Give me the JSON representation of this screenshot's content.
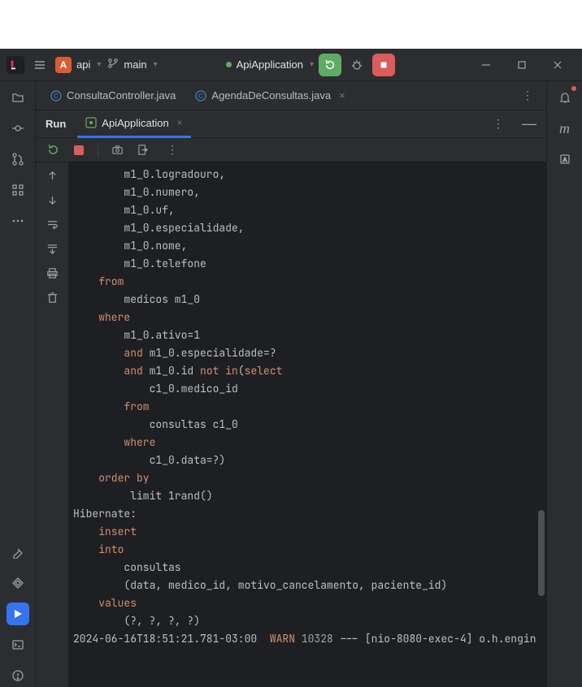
{
  "titlebar": {
    "project_badge": "A",
    "project_name": "api",
    "branch_name": "main",
    "run_config": "ApiApplication"
  },
  "editor_tabs": [
    {
      "name": "ConsultaController.java"
    },
    {
      "name": "AgendaDeConsultas.java"
    }
  ],
  "run_panel": {
    "label": "Run",
    "active_tab": "ApiApplication"
  },
  "console_lines": [
    {
      "indent": 8,
      "text": "m1_0.logradouro,"
    },
    {
      "indent": 8,
      "text": "m1_0.numero,"
    },
    {
      "indent": 8,
      "text": "m1_0.uf,"
    },
    {
      "indent": 8,
      "text": "m1_0.especialidade,"
    },
    {
      "indent": 8,
      "text": "m1_0.nome,"
    },
    {
      "indent": 8,
      "text": "m1_0.telefone "
    },
    {
      "indent": 4,
      "kw": "from"
    },
    {
      "indent": 8,
      "text": "medicos m1_0 "
    },
    {
      "indent": 4,
      "kw": "where"
    },
    {
      "indent": 8,
      "text": "m1_0.ativo=1 "
    },
    {
      "indent": 8,
      "kw": "and",
      "after": " m1_0.especialidade=? "
    },
    {
      "indent": 8,
      "kw": "and",
      "after": " m1_0.id ",
      "kw2": "not in",
      "after2": "(",
      "kw3": "select"
    },
    {
      "indent": 12,
      "text": "c1_0.medico_id "
    },
    {
      "indent": 8,
      "kw": "from"
    },
    {
      "indent": 12,
      "text": "consultas c1_0 "
    },
    {
      "indent": 8,
      "kw": "where"
    },
    {
      "indent": 12,
      "text": "c1_0.data=?) "
    },
    {
      "indent": 4,
      "kw": "order by"
    },
    {
      "indent": 8,
      "text": "rand",
      "paren": "()",
      "after": " limit 1"
    },
    {
      "indent": 0,
      "hib": "Hibernate: "
    },
    {
      "indent": 4,
      "kw": "insert"
    },
    {
      "indent": 4,
      "kw": "into"
    },
    {
      "indent": 8,
      "text": "consultas"
    },
    {
      "indent": 8,
      "text": "(data, medico_id, motivo_cancelamento, paciente_id) "
    },
    {
      "indent": 4,
      "kw": "values"
    },
    {
      "indent": 8,
      "text": "(?, ?, ?, ?)"
    }
  ],
  "log_line": {
    "timestamp": "2024-06-16T18:51:21.781-03:00",
    "level": "WARN",
    "pid": "10328",
    "sep": "---",
    "thread": "[nio-8080-exec-4]",
    "logger": "o.h.engin"
  },
  "right_strip_m": "m"
}
